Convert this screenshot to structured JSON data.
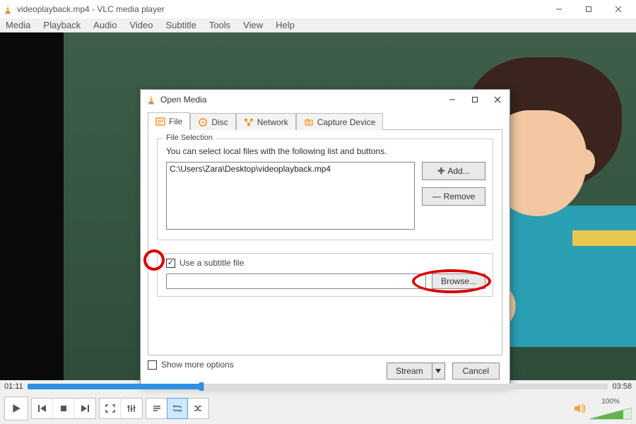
{
  "window": {
    "title": "videoplayback.mp4 - VLC media player"
  },
  "menu": {
    "items": [
      "Media",
      "Playback",
      "Audio",
      "Video",
      "Subtitle",
      "Tools",
      "View",
      "Help"
    ]
  },
  "dialog": {
    "title": "Open Media",
    "tabs": {
      "file": "File",
      "disc": "Disc",
      "network": "Network",
      "capture": "Capture Device"
    },
    "file_section": {
      "legend": "File Selection",
      "hint": "You can select local files with the following list and buttons.",
      "selected_file": "C:\\Users\\Zara\\Desktop\\videoplayback.mp4",
      "add": "Add...",
      "remove": "Remove"
    },
    "subtitle_section": {
      "checkbox_label": "Use a subtitle file",
      "checked": true,
      "browse": "Browse..."
    },
    "show_more": "Show more options",
    "stream": "Stream",
    "cancel": "Cancel"
  },
  "playback": {
    "elapsed": "01:11",
    "total": "03:58",
    "progress_percent": 30,
    "volume_label": "100%"
  }
}
